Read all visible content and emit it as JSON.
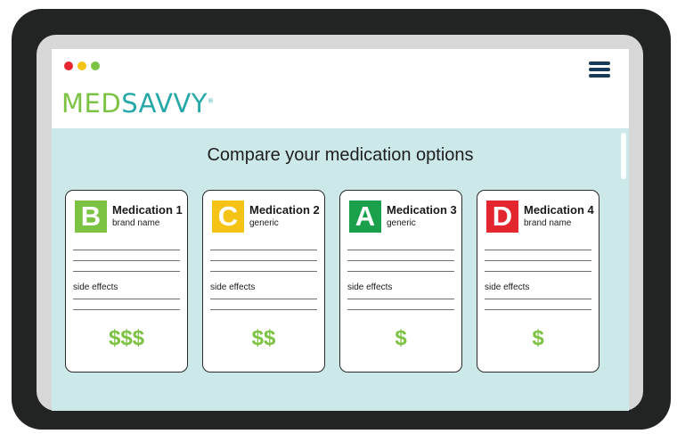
{
  "window": {
    "dots": [
      "#e8262f",
      "#f5c315",
      "#7cc243"
    ]
  },
  "header": {
    "logo_part1": "MED",
    "logo_part2": "SAVVY",
    "logo_mark": "®",
    "logo_colors": {
      "med": "#7cc243",
      "savvy": "#27a8a8"
    },
    "menu_icon": "hamburger-menu-icon"
  },
  "main": {
    "title": "Compare your medication options",
    "side_effects_label": "side effects",
    "cards": [
      {
        "grade": "B",
        "grade_color": "#7cc243",
        "name": "Medication 1",
        "type": "brand name",
        "price": "$$$"
      },
      {
        "grade": "C",
        "grade_color": "#f5c315",
        "name": "Medication 2",
        "type": "generic",
        "price": "$$"
      },
      {
        "grade": "A",
        "grade_color": "#1aa04a",
        "name": "Medication 3",
        "type": "generic",
        "price": "$"
      },
      {
        "grade": "D",
        "grade_color": "#e3262d",
        "name": "Medication 4",
        "type": "brand name",
        "price": "$"
      }
    ]
  }
}
